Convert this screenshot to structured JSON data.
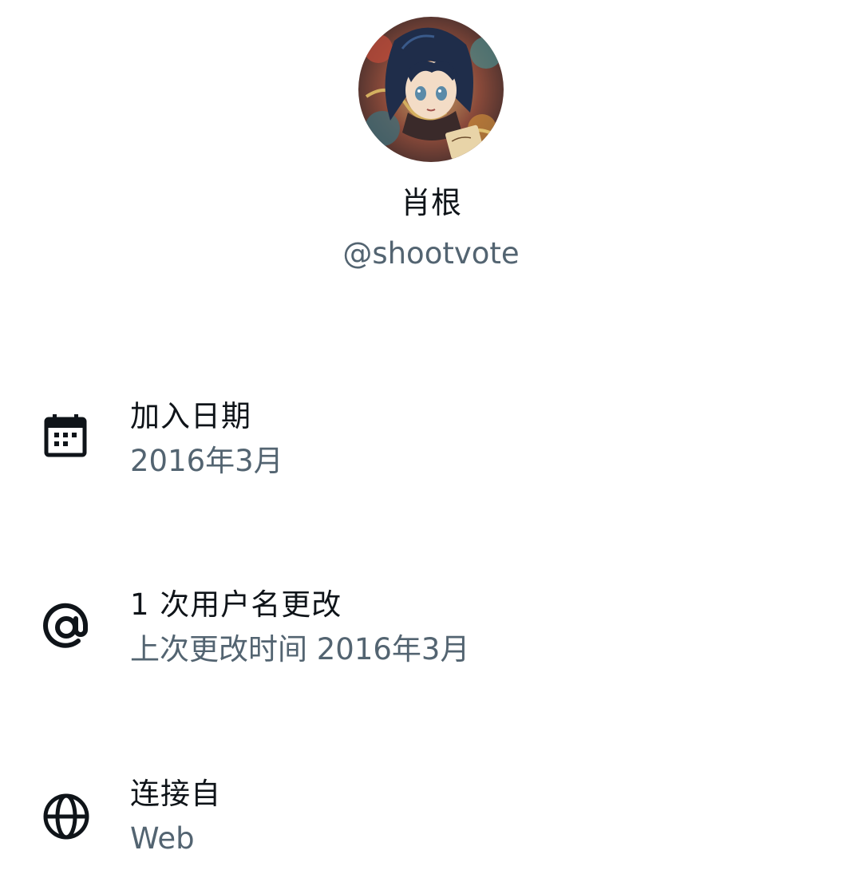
{
  "profile": {
    "display_name": "肖根",
    "handle": "@shootvote",
    "avatar_icon": "anime-character-avatar"
  },
  "info_rows": [
    {
      "icon": "calendar-icon",
      "title": "加入日期",
      "subtitle": "2016年3月"
    },
    {
      "icon": "at-sign-icon",
      "title": "1 次用户名更改",
      "subtitle": "上次更改时间 2016年3月"
    },
    {
      "icon": "globe-icon",
      "title": "连接自",
      "subtitle": "Web"
    }
  ],
  "colors": {
    "primary_text": "#0f1419",
    "secondary_text": "#536471",
    "background": "#ffffff"
  }
}
